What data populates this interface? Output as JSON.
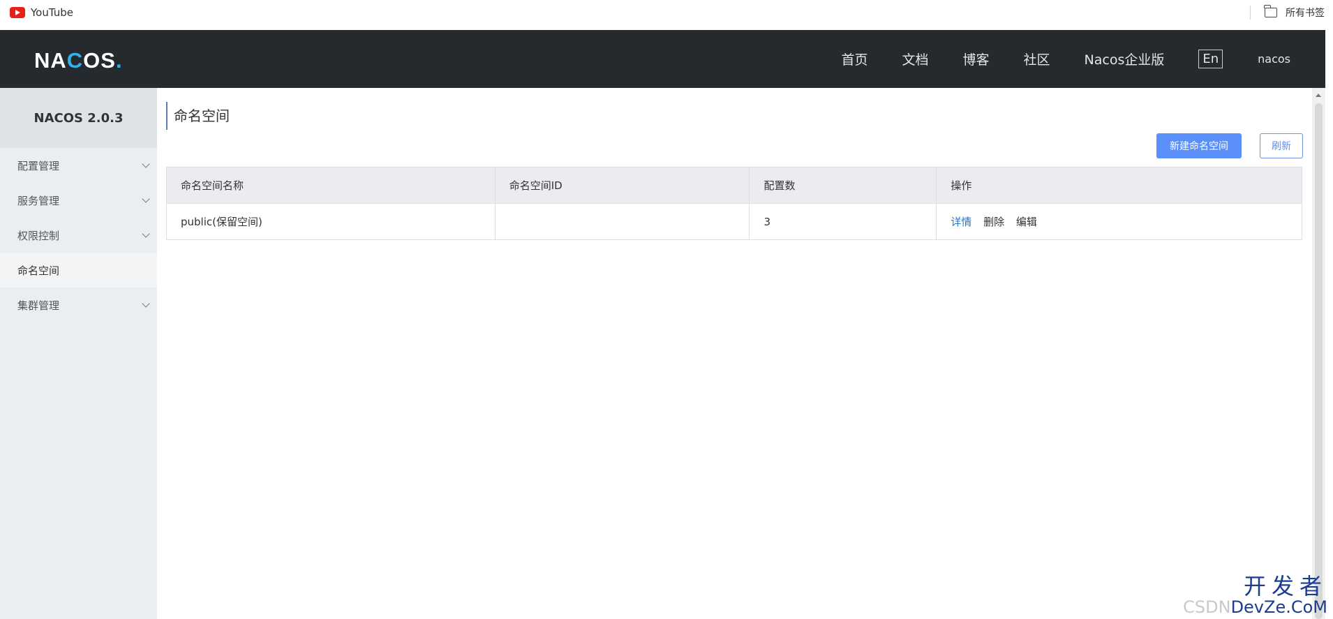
{
  "bookmarks": {
    "left_item": "YouTube",
    "right_item": "所有书签"
  },
  "topnav": {
    "logo": {
      "part1": "NA",
      "part2": "C",
      "part3": "OS",
      "dot": "."
    },
    "links": [
      "首页",
      "文档",
      "博客",
      "社区",
      "Nacos企业版"
    ],
    "lang": "En",
    "user": "nacos"
  },
  "sidebar": {
    "title": "NACOS 2.0.3",
    "items": [
      {
        "label": "配置管理",
        "expandable": true
      },
      {
        "label": "服务管理",
        "expandable": true
      },
      {
        "label": "权限控制",
        "expandable": true
      },
      {
        "label": "命名空间",
        "expandable": false,
        "active": true
      },
      {
        "label": "集群管理",
        "expandable": true
      }
    ]
  },
  "main": {
    "title": "命名空间",
    "new_button": "新建命名空间",
    "refresh_button": "刷新",
    "table": {
      "headers": [
        "命名空间名称",
        "命名空间ID",
        "配置数",
        "操作"
      ],
      "rows": [
        {
          "name": "public(保留空间)",
          "id": "",
          "count": "3",
          "ops": [
            "详情",
            "删除",
            "编辑"
          ]
        }
      ]
    }
  },
  "watermark": {
    "top": "开发者",
    "csdn": "CSDN",
    "dev": "DevZe.CoM"
  },
  "colors": {
    "nav_bg": "#252a2f",
    "primary": "#5b8ff9",
    "link": "#2e74c1",
    "sidebar_bg": "#eaedf1"
  }
}
